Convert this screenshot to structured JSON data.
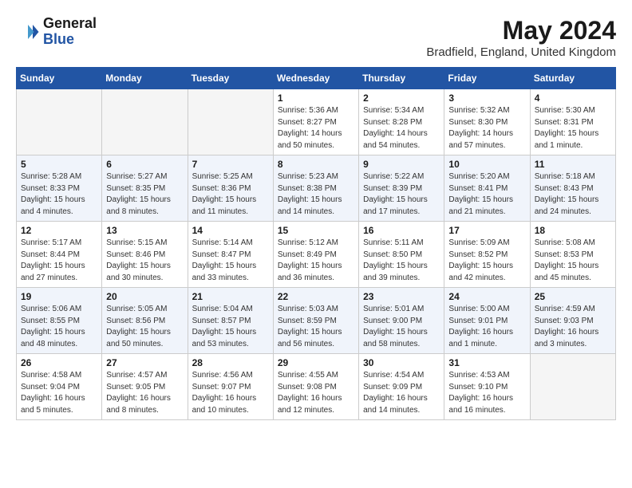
{
  "header": {
    "logo_line1": "General",
    "logo_line2": "Blue",
    "month": "May 2024",
    "location": "Bradfield, England, United Kingdom"
  },
  "weekdays": [
    "Sunday",
    "Monday",
    "Tuesday",
    "Wednesday",
    "Thursday",
    "Friday",
    "Saturday"
  ],
  "weeks": [
    [
      {
        "day": "",
        "info": ""
      },
      {
        "day": "",
        "info": ""
      },
      {
        "day": "",
        "info": ""
      },
      {
        "day": "1",
        "info": "Sunrise: 5:36 AM\nSunset: 8:27 PM\nDaylight: 14 hours\nand 50 minutes."
      },
      {
        "day": "2",
        "info": "Sunrise: 5:34 AM\nSunset: 8:28 PM\nDaylight: 14 hours\nand 54 minutes."
      },
      {
        "day": "3",
        "info": "Sunrise: 5:32 AM\nSunset: 8:30 PM\nDaylight: 14 hours\nand 57 minutes."
      },
      {
        "day": "4",
        "info": "Sunrise: 5:30 AM\nSunset: 8:31 PM\nDaylight: 15 hours\nand 1 minute."
      }
    ],
    [
      {
        "day": "5",
        "info": "Sunrise: 5:28 AM\nSunset: 8:33 PM\nDaylight: 15 hours\nand 4 minutes."
      },
      {
        "day": "6",
        "info": "Sunrise: 5:27 AM\nSunset: 8:35 PM\nDaylight: 15 hours\nand 8 minutes."
      },
      {
        "day": "7",
        "info": "Sunrise: 5:25 AM\nSunset: 8:36 PM\nDaylight: 15 hours\nand 11 minutes."
      },
      {
        "day": "8",
        "info": "Sunrise: 5:23 AM\nSunset: 8:38 PM\nDaylight: 15 hours\nand 14 minutes."
      },
      {
        "day": "9",
        "info": "Sunrise: 5:22 AM\nSunset: 8:39 PM\nDaylight: 15 hours\nand 17 minutes."
      },
      {
        "day": "10",
        "info": "Sunrise: 5:20 AM\nSunset: 8:41 PM\nDaylight: 15 hours\nand 21 minutes."
      },
      {
        "day": "11",
        "info": "Sunrise: 5:18 AM\nSunset: 8:43 PM\nDaylight: 15 hours\nand 24 minutes."
      }
    ],
    [
      {
        "day": "12",
        "info": "Sunrise: 5:17 AM\nSunset: 8:44 PM\nDaylight: 15 hours\nand 27 minutes."
      },
      {
        "day": "13",
        "info": "Sunrise: 5:15 AM\nSunset: 8:46 PM\nDaylight: 15 hours\nand 30 minutes."
      },
      {
        "day": "14",
        "info": "Sunrise: 5:14 AM\nSunset: 8:47 PM\nDaylight: 15 hours\nand 33 minutes."
      },
      {
        "day": "15",
        "info": "Sunrise: 5:12 AM\nSunset: 8:49 PM\nDaylight: 15 hours\nand 36 minutes."
      },
      {
        "day": "16",
        "info": "Sunrise: 5:11 AM\nSunset: 8:50 PM\nDaylight: 15 hours\nand 39 minutes."
      },
      {
        "day": "17",
        "info": "Sunrise: 5:09 AM\nSunset: 8:52 PM\nDaylight: 15 hours\nand 42 minutes."
      },
      {
        "day": "18",
        "info": "Sunrise: 5:08 AM\nSunset: 8:53 PM\nDaylight: 15 hours\nand 45 minutes."
      }
    ],
    [
      {
        "day": "19",
        "info": "Sunrise: 5:06 AM\nSunset: 8:55 PM\nDaylight: 15 hours\nand 48 minutes."
      },
      {
        "day": "20",
        "info": "Sunrise: 5:05 AM\nSunset: 8:56 PM\nDaylight: 15 hours\nand 50 minutes."
      },
      {
        "day": "21",
        "info": "Sunrise: 5:04 AM\nSunset: 8:57 PM\nDaylight: 15 hours\nand 53 minutes."
      },
      {
        "day": "22",
        "info": "Sunrise: 5:03 AM\nSunset: 8:59 PM\nDaylight: 15 hours\nand 56 minutes."
      },
      {
        "day": "23",
        "info": "Sunrise: 5:01 AM\nSunset: 9:00 PM\nDaylight: 15 hours\nand 58 minutes."
      },
      {
        "day": "24",
        "info": "Sunrise: 5:00 AM\nSunset: 9:01 PM\nDaylight: 16 hours\nand 1 minute."
      },
      {
        "day": "25",
        "info": "Sunrise: 4:59 AM\nSunset: 9:03 PM\nDaylight: 16 hours\nand 3 minutes."
      }
    ],
    [
      {
        "day": "26",
        "info": "Sunrise: 4:58 AM\nSunset: 9:04 PM\nDaylight: 16 hours\nand 5 minutes."
      },
      {
        "day": "27",
        "info": "Sunrise: 4:57 AM\nSunset: 9:05 PM\nDaylight: 16 hours\nand 8 minutes."
      },
      {
        "day": "28",
        "info": "Sunrise: 4:56 AM\nSunset: 9:07 PM\nDaylight: 16 hours\nand 10 minutes."
      },
      {
        "day": "29",
        "info": "Sunrise: 4:55 AM\nSunset: 9:08 PM\nDaylight: 16 hours\nand 12 minutes."
      },
      {
        "day": "30",
        "info": "Sunrise: 4:54 AM\nSunset: 9:09 PM\nDaylight: 16 hours\nand 14 minutes."
      },
      {
        "day": "31",
        "info": "Sunrise: 4:53 AM\nSunset: 9:10 PM\nDaylight: 16 hours\nand 16 minutes."
      },
      {
        "day": "",
        "info": ""
      }
    ]
  ]
}
